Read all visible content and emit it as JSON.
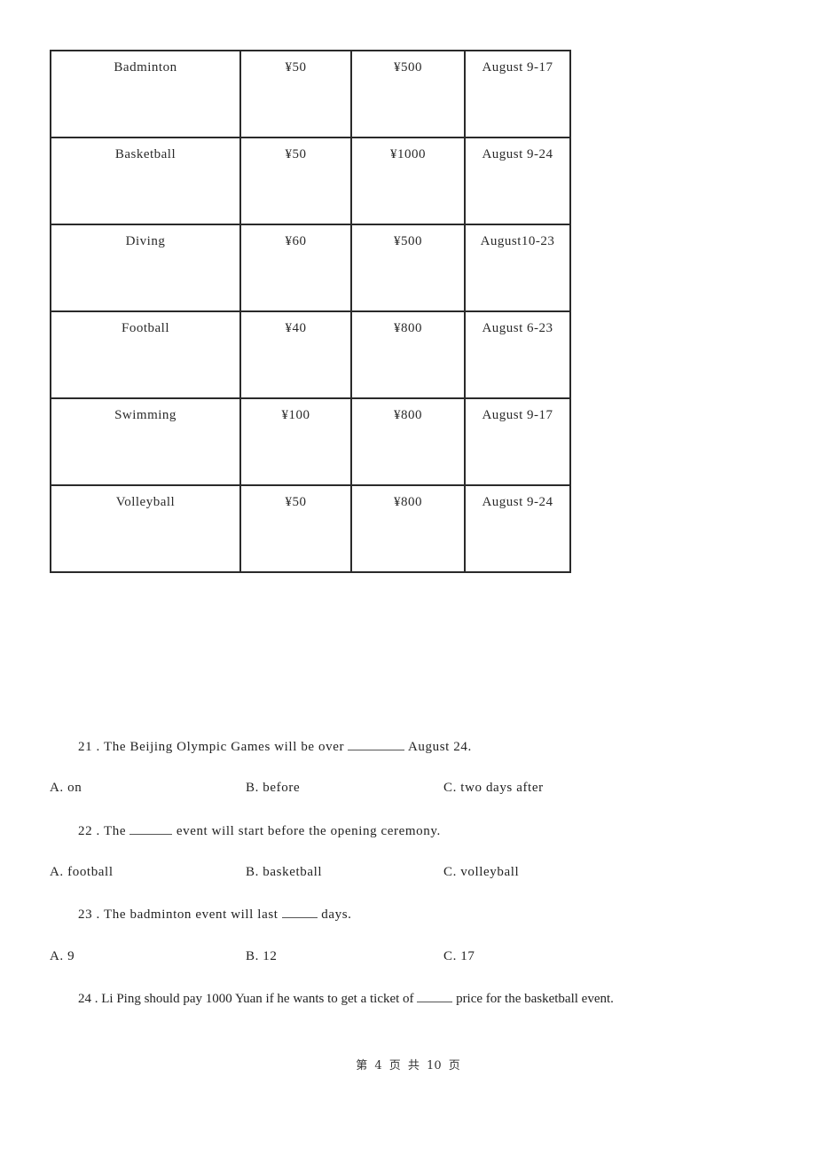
{
  "table": {
    "rows": [
      {
        "event": "Badminton",
        "low_price": "¥50",
        "high_price": "¥500",
        "dates": "August 9-17"
      },
      {
        "event": "Basketball",
        "low_price": "¥50",
        "high_price": "¥1000",
        "dates": "August 9-24"
      },
      {
        "event": "Diving",
        "low_price": "¥60",
        "high_price": "¥500",
        "dates": "August10-23"
      },
      {
        "event": "Football",
        "low_price": "¥40",
        "high_price": "¥800",
        "dates": "August 6-23"
      },
      {
        "event": "Swimming",
        "low_price": "¥100",
        "high_price": "¥800",
        "dates": "August 9-17"
      },
      {
        "event": "Volleyball",
        "low_price": "¥50",
        "high_price": "¥800",
        "dates": "August 9-24"
      }
    ]
  },
  "questions": [
    {
      "number": "21 .",
      "before_blank": "The Beijing Olympic Games will be over",
      "after_blank": "August 24.",
      "options": {
        "a": "A. on",
        "b": "B. before",
        "c": "C. two days after"
      }
    },
    {
      "number": "22 .",
      "before_blank": "The",
      "after_blank": "event will start before the opening ceremony.",
      "options": {
        "a": "A. football",
        "b": "B. basketball",
        "c": "C. volleyball"
      }
    },
    {
      "number": "23 .",
      "before_blank": "The badminton event will last",
      "after_blank": "days.",
      "options": {
        "a": "A. 9",
        "b": "B. 12",
        "c": "C. 17"
      }
    },
    {
      "number": "24 .",
      "before_blank": "Li Ping should pay 1000 Yuan if he wants to get a ticket of",
      "after_blank": "price for the basketball event."
    }
  ],
  "footer": {
    "page_label": "第 4 页 共 10 页"
  }
}
